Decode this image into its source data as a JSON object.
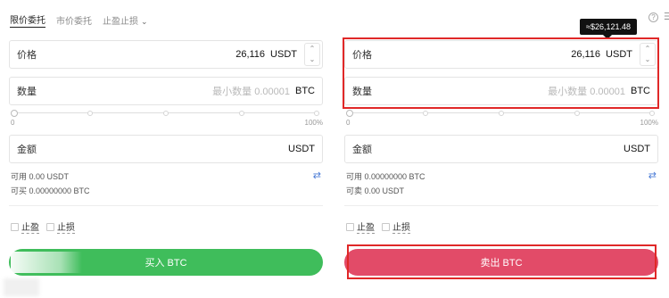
{
  "tabs": {
    "limit": "限价委托",
    "market": "市价委托",
    "stop": "止盈止损",
    "stop_chevron": "⌄"
  },
  "tooltip": {
    "text": "≈$26,121.48"
  },
  "icons": {
    "help": "?",
    "menu": "☰",
    "swap": "⇄",
    "up": "⌃",
    "down": "⌄"
  },
  "buy": {
    "price_label": "价格",
    "price_value": "26,116",
    "price_unit": "USDT",
    "qty_label": "数量",
    "qty_placeholder": "最小数量 0.00001",
    "qty_unit": "BTC",
    "slider_min": "0",
    "slider_max": "100%",
    "amount_label": "金额",
    "amount_unit": "USDT",
    "available": "可用 0.00 USDT",
    "can_buy": "可买 0.00000000 BTC",
    "take_profit": "止盈",
    "stop_loss": "止损",
    "button": "买入 BTC"
  },
  "sell": {
    "price_label": "价格",
    "price_value": "26,116",
    "price_unit": "USDT",
    "qty_label": "数量",
    "qty_placeholder": "最小数量 0.00001",
    "qty_unit": "BTC",
    "slider_min": "0",
    "slider_max": "100%",
    "amount_label": "金额",
    "amount_unit": "USDT",
    "available": "可用 0.00000000 BTC",
    "can_sell": "可卖 0.00 USDT",
    "take_profit": "止盈",
    "stop_loss": "止损",
    "button": "卖出 BTC"
  },
  "colors": {
    "buy": "#3fbd5b",
    "sell": "#e24b68",
    "highlight": "#e02828",
    "link": "#4a7bd6"
  }
}
